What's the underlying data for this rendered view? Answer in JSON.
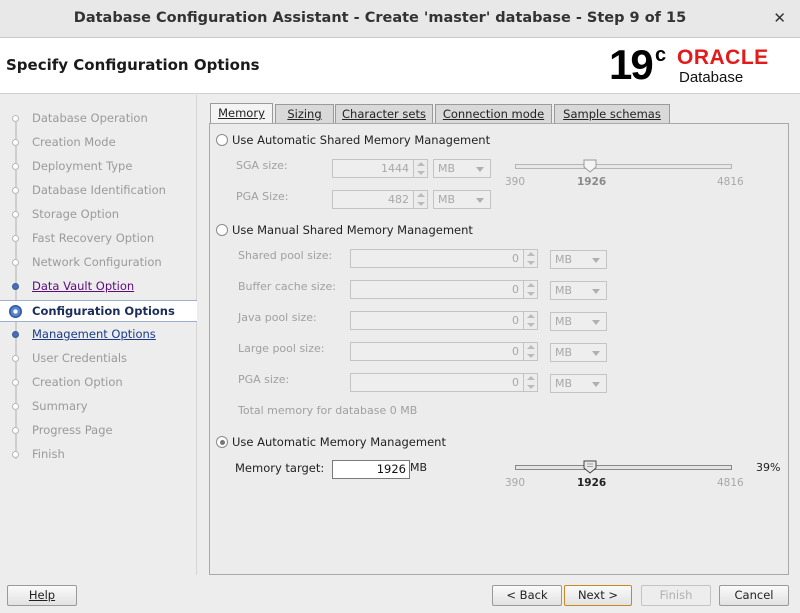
{
  "window": {
    "title": "Database Configuration Assistant - Create 'master' database - Step 9 of 15"
  },
  "header": {
    "page_title": "Specify Configuration Options",
    "logo_version": "19",
    "logo_suffix": "c",
    "logo_brand": "ORACLE",
    "logo_product": "Database",
    "brand_color": "#e21a1a"
  },
  "nav": {
    "items": [
      {
        "label": "Database Operation",
        "state": "done"
      },
      {
        "label": "Creation Mode",
        "state": "done"
      },
      {
        "label": "Deployment Type",
        "state": "done"
      },
      {
        "label": "Database Identification",
        "state": "done"
      },
      {
        "label": "Storage Option",
        "state": "done"
      },
      {
        "label": "Fast Recovery Option",
        "state": "done"
      },
      {
        "label": "Network Configuration",
        "state": "done"
      },
      {
        "label": "Data Vault Option",
        "state": "link"
      },
      {
        "label": "Configuration Options",
        "state": "active"
      },
      {
        "label": "Management Options",
        "state": "link"
      },
      {
        "label": "User Credentials",
        "state": "pending"
      },
      {
        "label": "Creation Option",
        "state": "pending"
      },
      {
        "label": "Summary",
        "state": "pending"
      },
      {
        "label": "Progress Page",
        "state": "pending"
      },
      {
        "label": "Finish",
        "state": "pending"
      }
    ]
  },
  "tabs": [
    {
      "label": "Memory",
      "selected": true
    },
    {
      "label": "Sizing",
      "selected": false
    },
    {
      "label": "Character sets",
      "selected": false
    },
    {
      "label": "Connection mode",
      "selected": false
    },
    {
      "label": "Sample schemas",
      "selected": false
    }
  ],
  "asmm": {
    "label": "Use Automatic Shared Memory Management",
    "sga_label": "SGA size:",
    "sga_value": "1444",
    "sga_unit": "MB",
    "pga_label": "PGA Size:",
    "pga_value": "482",
    "pga_unit": "MB",
    "slider": {
      "min": "390",
      "value": "1926",
      "max": "4816",
      "value_num": 1926,
      "min_num": 390,
      "max_num": 4816
    }
  },
  "manual": {
    "label": "Use Manual Shared Memory Management",
    "rows": [
      {
        "label": "Shared pool size:",
        "value": "0",
        "unit": "MB"
      },
      {
        "label": "Buffer cache size:",
        "value": "0",
        "unit": "MB"
      },
      {
        "label": "Java pool size:",
        "value": "0",
        "unit": "MB"
      },
      {
        "label": "Large pool size:",
        "value": "0",
        "unit": "MB"
      },
      {
        "label": "PGA size:",
        "value": "0",
        "unit": "MB"
      }
    ],
    "total": "Total memory for database 0 MB"
  },
  "amm": {
    "label": "Use Automatic Memory Management",
    "selected": true,
    "target_label": "Memory target:",
    "target_value": "1926",
    "target_unit": "MB",
    "percent": "39%",
    "slider": {
      "min": "390",
      "value": "1926",
      "max": "4816",
      "value_num": 1926,
      "min_num": 390,
      "max_num": 4816
    }
  },
  "buttons": {
    "help": "Help",
    "back": "< Back",
    "next": "Next >",
    "finish": "Finish",
    "cancel": "Cancel"
  }
}
